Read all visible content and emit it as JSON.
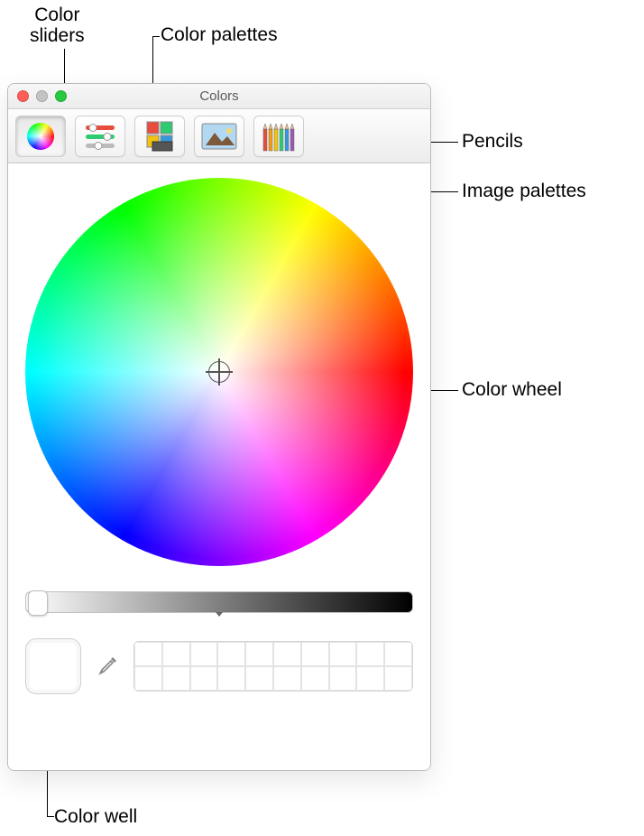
{
  "window": {
    "title": "Colors"
  },
  "callouts": {
    "sliders": "Color sliders",
    "palettes": "Color palettes",
    "pencils": "Pencils",
    "image_palettes": "Image palettes",
    "wheel": "Color wheel",
    "well": "Color well"
  },
  "toolbar": {
    "wheel_tab": "Color Wheel",
    "sliders_tab": "Color Sliders",
    "palettes_tab": "Color Palettes",
    "image_tab": "Image Palettes",
    "pencils_tab": "Pencils"
  },
  "controls": {
    "brightness_value": 100,
    "current_color": "#ffffff",
    "swatch_count": 20
  }
}
